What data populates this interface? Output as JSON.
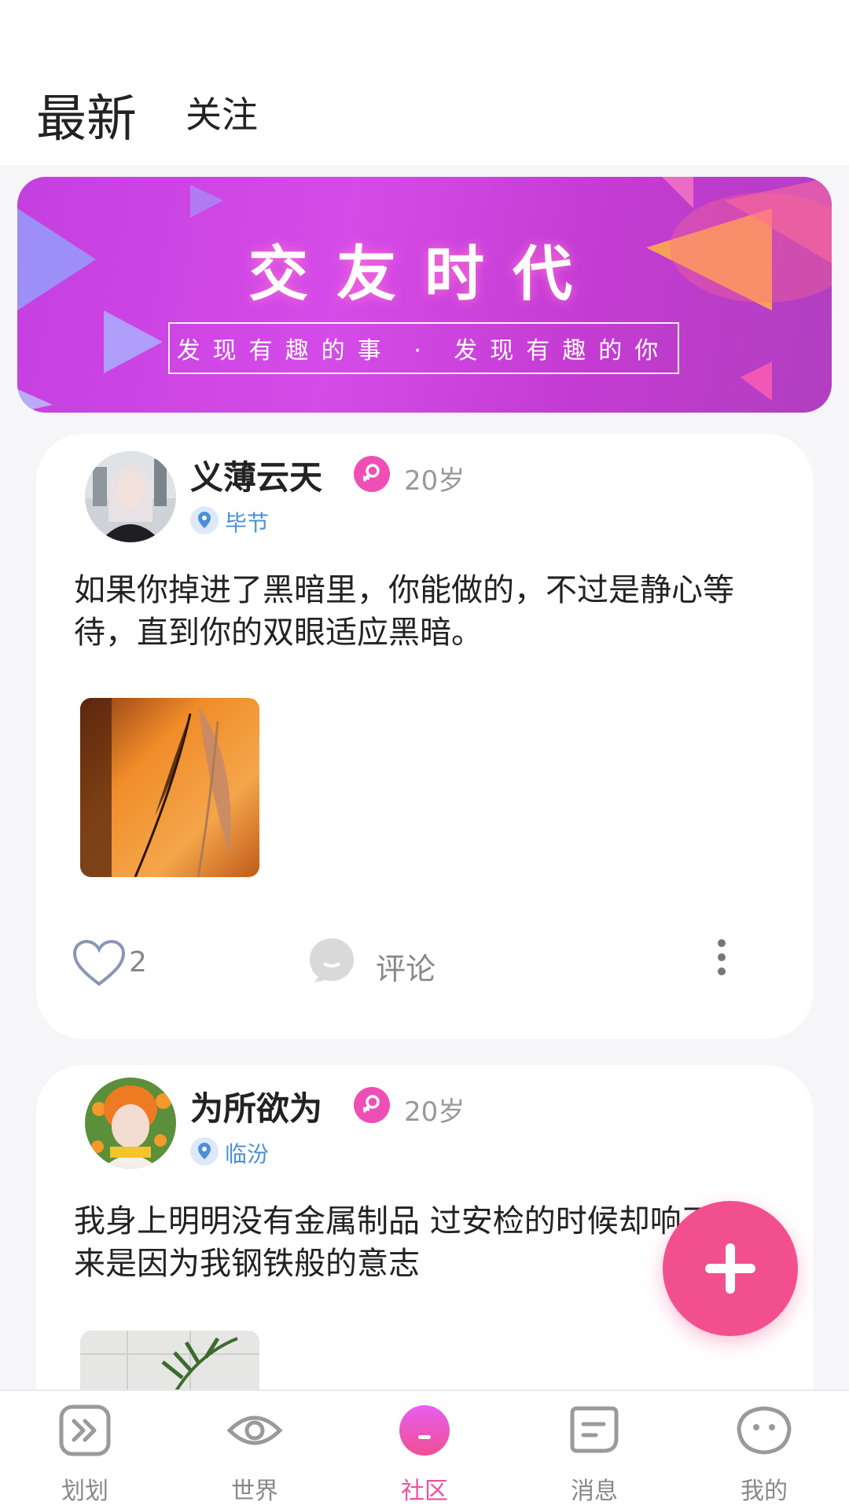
{
  "header": {
    "tabs": [
      {
        "label": "最新",
        "active": true
      },
      {
        "label": "关注",
        "active": false
      }
    ]
  },
  "banner": {
    "title": "交友时代",
    "subtitle": "发现有趣的事 · 发现有趣的你"
  },
  "posts": [
    {
      "username": "义薄云天",
      "gender": "female",
      "age": "20岁",
      "location": "毕节",
      "text": "如果你掉进了黑暗里，你能做的，不过是静心等待，直到你的双眼适应黑暗。",
      "likes": "2",
      "comment_label": "评论"
    },
    {
      "username": "为所欲为",
      "gender": "female",
      "age": "20岁",
      "location": "临汾",
      "text": "我身上明明没有金属制品 过安检的时候却响了 原来是因为我钢铁般的意志"
    }
  ],
  "nav": {
    "items": [
      {
        "label": "划划",
        "icon": "swipe-icon",
        "active": false
      },
      {
        "label": "世界",
        "icon": "eye-icon",
        "active": false
      },
      {
        "label": "社区",
        "icon": "community-icon",
        "active": true
      },
      {
        "label": "消息",
        "icon": "message-icon",
        "active": false
      },
      {
        "label": "我的",
        "icon": "profile-icon",
        "active": false
      }
    ]
  },
  "colors": {
    "accent": "#ef4fa0",
    "fab": "#f24f8f",
    "banner": "#c53fe0",
    "location": "#4b8fd6"
  }
}
